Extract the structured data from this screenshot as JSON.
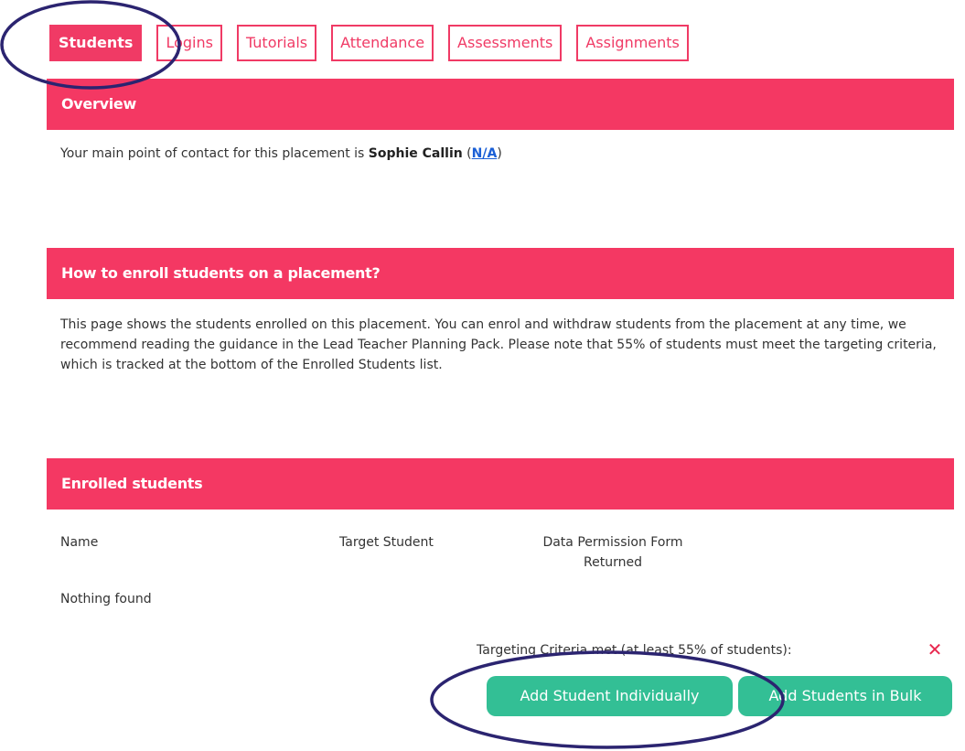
{
  "tabs": [
    {
      "label": "Students",
      "active": true
    },
    {
      "label": "Logins"
    },
    {
      "label": "Tutorials"
    },
    {
      "label": "Attendance"
    },
    {
      "label": "Assessments"
    },
    {
      "label": "Assignments"
    }
  ],
  "overview": {
    "heading": "Overview",
    "contact_prefix": "Your main point of contact for this placement is ",
    "contact_name": "Sophie Callin",
    "contact_open": " (",
    "contact_link": "N/A",
    "contact_close": ")"
  },
  "enroll_help": {
    "heading": "How to enroll students on a placement?",
    "body": "This page shows the students enrolled on this placement. You can enrol and withdraw students from the placement at any time, we recommend reading the guidance in the Lead Teacher Planning Pack. Please note that 55% of students must meet the targeting criteria, which is tracked at the bottom of the Enrolled Students list."
  },
  "enrolled": {
    "heading": "Enrolled students",
    "columns": {
      "name": "Name",
      "target": "Target Student",
      "permission_line1": "Data Permission Form",
      "permission_line2": "Returned"
    },
    "empty_text": "Nothing found",
    "criteria_text": "Targeting Criteria met (at least 55% of students):",
    "criteria_status_icon": "cross-icon"
  },
  "buttons": {
    "add_individual": "Add Student Individually",
    "add_bulk": "Add Students in Bulk"
  },
  "colors": {
    "accent": "#f43863",
    "button": "#33bf95",
    "annotation": "#2b2470"
  }
}
